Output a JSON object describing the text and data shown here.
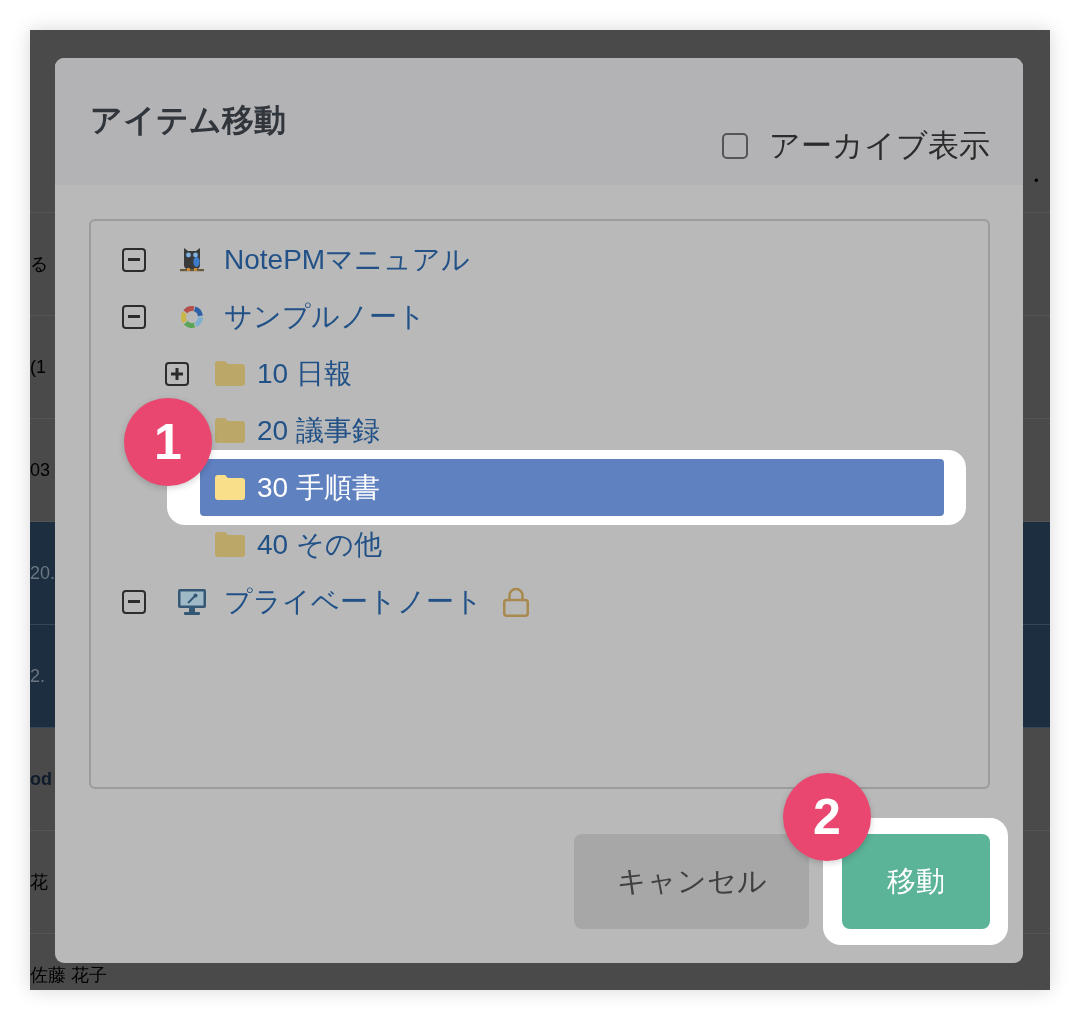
{
  "background_page": {
    "header_fragment": "・",
    "rows": [
      {
        "kind": "plain",
        "text": "る"
      },
      {
        "kind": "plain",
        "text": "(1"
      },
      {
        "kind": "plain",
        "text": "03"
      },
      {
        "kind": "dark",
        "text": "20."
      },
      {
        "kind": "dark",
        "text": "2."
      },
      {
        "kind": "heading",
        "text": "od"
      },
      {
        "kind": "plain",
        "text": "花"
      },
      {
        "kind": "plain",
        "text": "佐藤 花子"
      }
    ]
  },
  "dialog": {
    "title": "アイテム移動",
    "archive_toggle": {
      "label": "アーカイブ表示",
      "checked": false
    }
  },
  "tree": [
    {
      "kind": "owl",
      "label": "NotePMマニュアル",
      "expanded": true,
      "selected": false,
      "locked": false
    },
    {
      "kind": "ring",
      "label": "サンプルノート",
      "expanded": true,
      "selected": false,
      "locked": false,
      "children": [
        {
          "kind": "folder",
          "label": "10 日報",
          "expanded": false,
          "selected": false
        },
        {
          "kind": "folder",
          "label": "20 議事録",
          "selected": false
        },
        {
          "kind": "folder",
          "label": "30 手順書",
          "selected": true,
          "callout": "1"
        },
        {
          "kind": "folder",
          "label": "40 その他",
          "selected": false
        }
      ]
    },
    {
      "kind": "monitor",
      "label": "プライベートノート",
      "expanded": true,
      "selected": false,
      "locked": true
    }
  ],
  "buttons": [
    {
      "kind": "secondary",
      "label": "キャンセル"
    },
    {
      "kind": "primary",
      "label": "移動",
      "callout": "2"
    }
  ]
}
